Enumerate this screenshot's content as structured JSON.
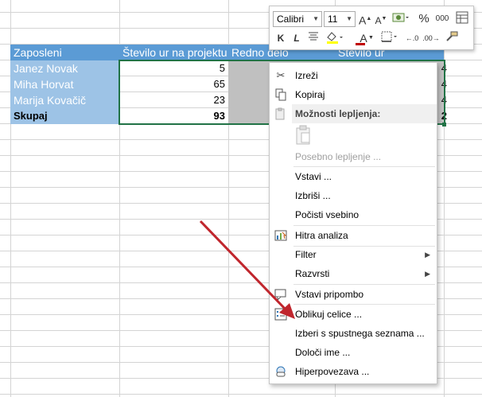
{
  "table": {
    "headers": [
      "Zaposleni",
      "Število ur na projektu",
      "Redno delo",
      "Število ur"
    ],
    "rows": [
      {
        "name": "Janez Novak",
        "hours": "5",
        "col4": "4"
      },
      {
        "name": "Miha Horvat",
        "hours": "65",
        "col4": "4"
      },
      {
        "name": "Marija Kovačič",
        "hours": "23",
        "col4": "4"
      }
    ],
    "total": {
      "name": "Skupaj",
      "hours": "93",
      "col4": "2"
    }
  },
  "minibar": {
    "font_name": "Calibri",
    "font_size": "11",
    "bold": "K",
    "italic": "L",
    "percent": "%",
    "thousands": "000",
    "font_color_letter": "A",
    "accent_color": "#c00000"
  },
  "context_menu": {
    "cut": "Izreži",
    "copy": "Kopiraj",
    "paste_options": "Možnosti lepljenja:",
    "paste_special": "Posebno lepljenje ...",
    "insert": "Vstavi ...",
    "delete": "Izbriši ...",
    "clear_contents": "Počisti vsebino",
    "quick_analysis": "Hitra analiza",
    "filter": "Filter",
    "sort": "Razvrsti",
    "insert_comment": "Vstavi pripombo",
    "format_cells": "Oblikuj celice ...",
    "pick_from_list": "Izberi s spustnega seznama ...",
    "define_name": "Določi ime ...",
    "hyperlink": "Hiperpovezava ..."
  },
  "colors": {
    "header_blue": "#5b9bd5",
    "name_blue": "#9dc3e6",
    "selection_green": "#217346",
    "annotation_arrow": "#c0262d"
  }
}
